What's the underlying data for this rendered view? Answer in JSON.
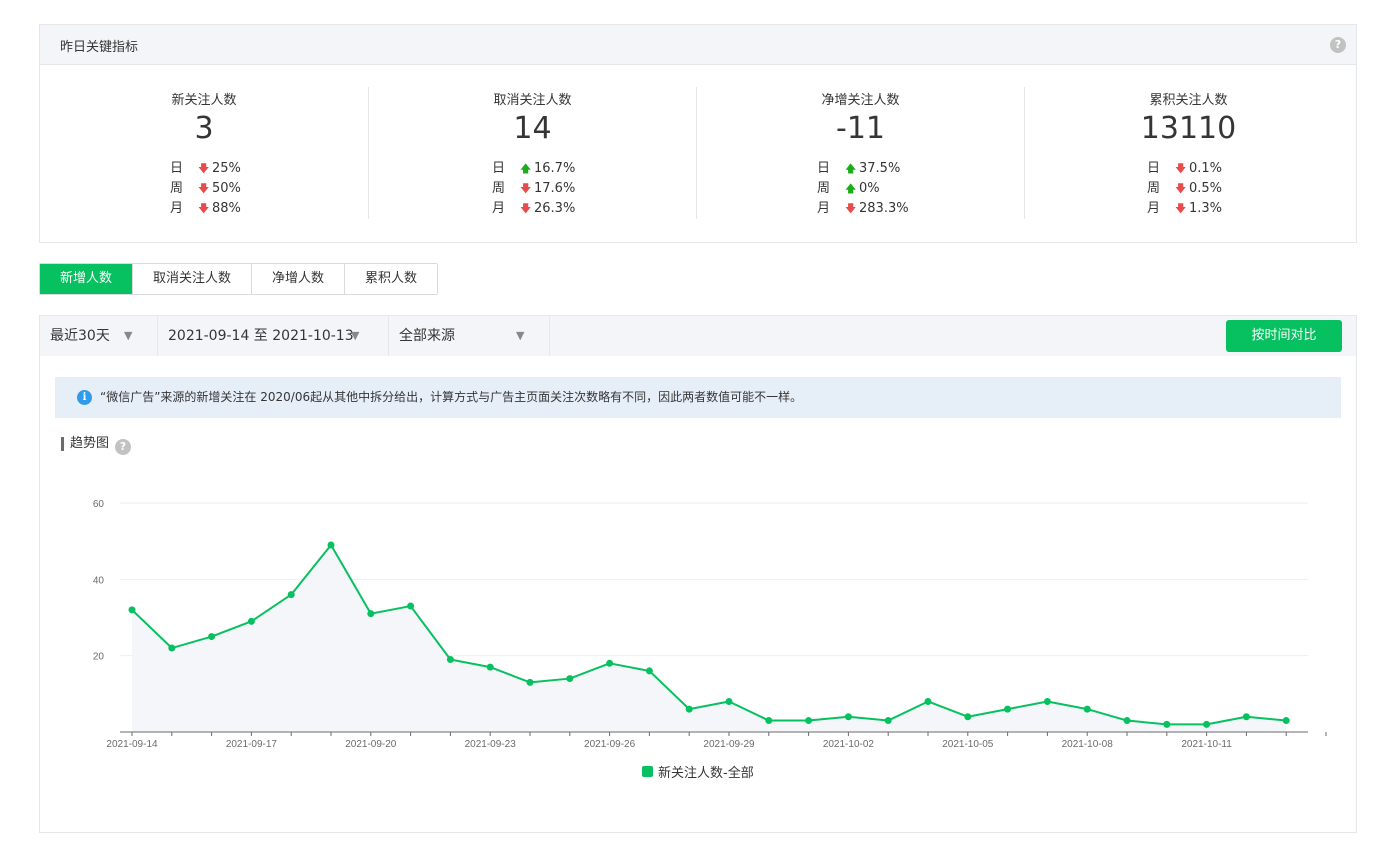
{
  "metrics": {
    "title": "昨日关键指标",
    "help_icon": "?",
    "items": [
      {
        "label": "新关注人数",
        "value": "3",
        "rows": [
          {
            "period": "日",
            "dir": "down",
            "pct": "25%"
          },
          {
            "period": "周",
            "dir": "down",
            "pct": "50%"
          },
          {
            "period": "月",
            "dir": "down",
            "pct": "88%"
          }
        ]
      },
      {
        "label": "取消关注人数",
        "value": "14",
        "rows": [
          {
            "period": "日",
            "dir": "up",
            "pct": "16.7%"
          },
          {
            "period": "周",
            "dir": "down",
            "pct": "17.6%"
          },
          {
            "period": "月",
            "dir": "down",
            "pct": "26.3%"
          }
        ]
      },
      {
        "label": "净增关注人数",
        "value": "-11",
        "rows": [
          {
            "period": "日",
            "dir": "up",
            "pct": "37.5%"
          },
          {
            "period": "周",
            "dir": "up",
            "pct": "0%"
          },
          {
            "period": "月",
            "dir": "down",
            "pct": "283.3%"
          }
        ]
      },
      {
        "label": "累积关注人数",
        "value": "13110",
        "rows": [
          {
            "period": "日",
            "dir": "down",
            "pct": "0.1%"
          },
          {
            "period": "周",
            "dir": "down",
            "pct": "0.5%"
          },
          {
            "period": "月",
            "dir": "down",
            "pct": "1.3%"
          }
        ]
      }
    ]
  },
  "tabs": [
    {
      "label": "新增人数",
      "active": true
    },
    {
      "label": "取消关注人数",
      "active": false
    },
    {
      "label": "净增人数",
      "active": false
    },
    {
      "label": "累积人数",
      "active": false
    }
  ],
  "filters": {
    "range": "最近30天",
    "dates": "2021-09-14 至 2021-10-13",
    "source": "全部来源",
    "compare_label": "按时间对比"
  },
  "notice": {
    "icon": "i",
    "text": "“微信广告”来源的新增关注在 2020/06起从其他中拆分给出，计算方式与广告主页面关注次数略有不同，因此两者数值可能不一样。"
  },
  "trend": {
    "title": "趋势图",
    "help_icon": "?"
  },
  "colors": {
    "accent": "#07c160",
    "up": "#1aad19",
    "down": "#e84b4b"
  },
  "chart_data": {
    "type": "line",
    "x": [
      "2021-09-14",
      "2021-09-15",
      "2021-09-16",
      "2021-09-17",
      "2021-09-18",
      "2021-09-19",
      "2021-09-20",
      "2021-09-21",
      "2021-09-22",
      "2021-09-23",
      "2021-09-24",
      "2021-09-25",
      "2021-09-26",
      "2021-09-27",
      "2021-09-28",
      "2021-09-29",
      "2021-09-30",
      "2021-10-01",
      "2021-10-02",
      "2021-10-03",
      "2021-10-04",
      "2021-10-05",
      "2021-10-06",
      "2021-10-07",
      "2021-10-08",
      "2021-10-09",
      "2021-10-10",
      "2021-10-11",
      "2021-10-12",
      "2021-10-13"
    ],
    "x_tick_labels": [
      "2021-09-14",
      "2021-09-17",
      "2021-09-20",
      "2021-09-23",
      "2021-09-26",
      "2021-09-29",
      "2021-10-02",
      "2021-10-05",
      "2021-10-08",
      "2021-10-11"
    ],
    "y_ticks": [
      "20",
      "40",
      "60"
    ],
    "ylim": [
      0,
      60
    ],
    "series": [
      {
        "name": "新关注人数-全部",
        "color": "#07c160",
        "values": [
          32,
          22,
          25,
          29,
          36,
          49,
          31,
          33,
          19,
          17,
          13,
          14,
          18,
          16,
          6,
          8,
          3,
          3,
          4,
          3,
          8,
          4,
          6,
          8,
          6,
          3,
          2,
          2,
          4,
          3
        ]
      }
    ],
    "grid": true,
    "legend": "bottom-center"
  }
}
